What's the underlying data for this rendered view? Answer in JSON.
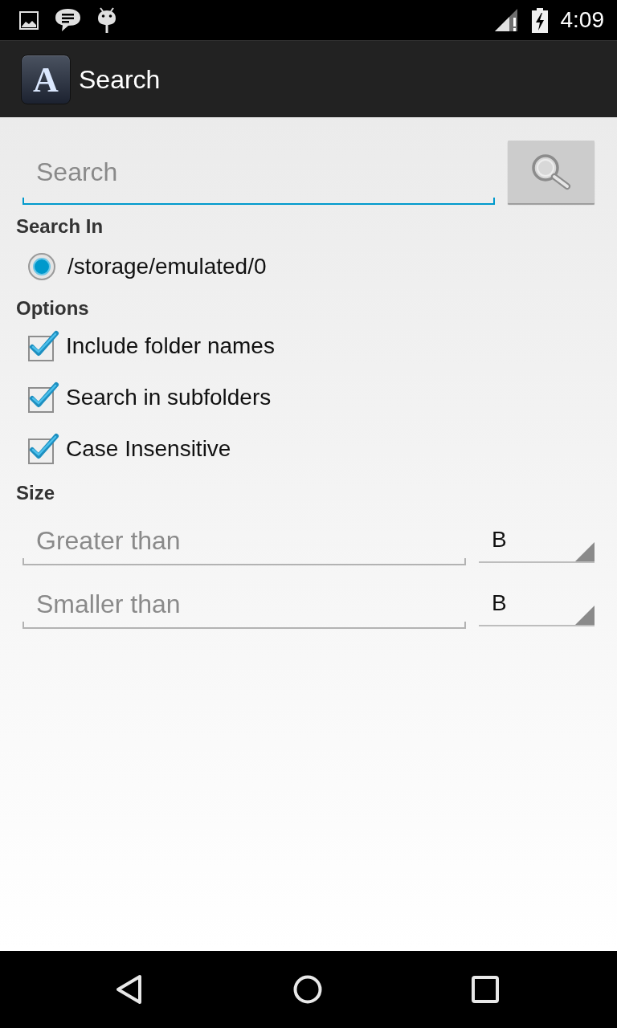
{
  "status_bar": {
    "time": "4:09"
  },
  "action_bar": {
    "logo_letter": "A",
    "title": "Search"
  },
  "search": {
    "placeholder": "Search",
    "focused": true
  },
  "search_in": {
    "heading": "Search In",
    "locations": [
      {
        "label": "/storage/emulated/0",
        "selected": true
      }
    ]
  },
  "options": {
    "heading": "Options",
    "items": [
      {
        "label": "Include folder names",
        "checked": true
      },
      {
        "label": "Search in subfolders",
        "checked": true
      },
      {
        "label": "Case Insensitive",
        "checked": true
      }
    ]
  },
  "size": {
    "heading": "Size",
    "filters": [
      {
        "placeholder": "Greater than",
        "focused": false,
        "unit": "B"
      },
      {
        "placeholder": "Smaller than",
        "focused": false,
        "unit": "B"
      }
    ]
  }
}
